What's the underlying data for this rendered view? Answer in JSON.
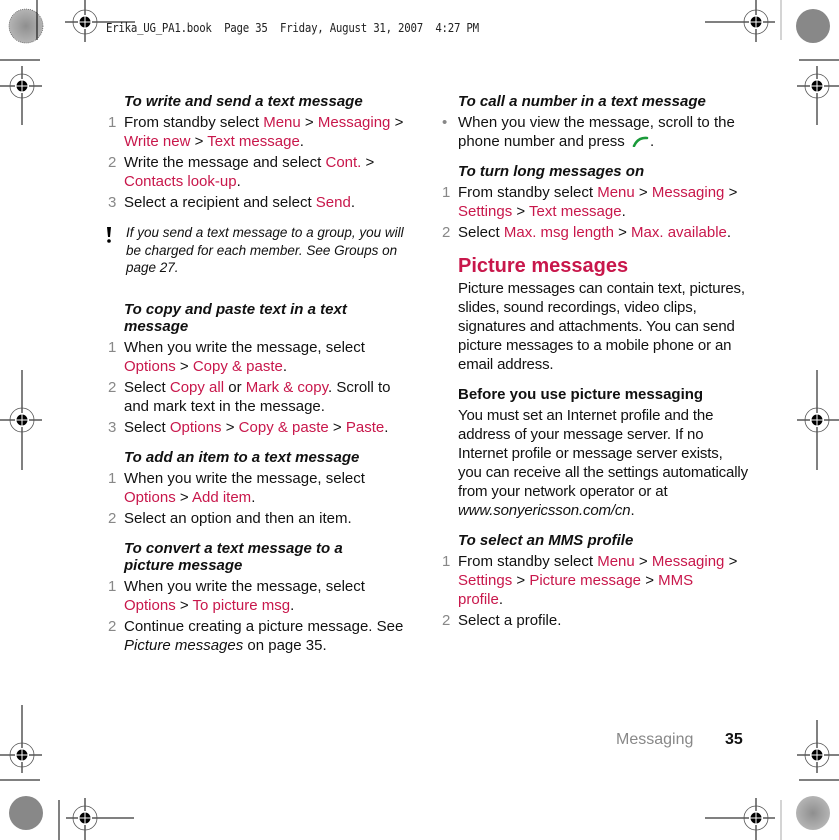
{
  "print_header": "Erika_UG_PA1.book  Page 35  Friday, August 31, 2007  4:27 PM",
  "colors": {
    "accent": "#c8174b",
    "step_number": "#888888",
    "call_key": "#1a9a3a"
  },
  "left_column": {
    "write_send": {
      "heading": "To write and send a text message",
      "steps": [
        {
          "num": "1",
          "parts": [
            "From standby select ",
            {
              "link": "Menu"
            },
            " > ",
            {
              "link": "Messaging"
            },
            " > ",
            {
              "link": "Write new"
            },
            " > ",
            {
              "link": "Text message"
            },
            "."
          ]
        },
        {
          "num": "2",
          "parts": [
            "Write the message and select ",
            {
              "link": "Cont."
            },
            " > ",
            {
              "link": "Contacts look-up"
            },
            "."
          ]
        },
        {
          "num": "3",
          "parts": [
            "Select a recipient and select ",
            {
              "link": "Send"
            },
            "."
          ]
        }
      ]
    },
    "note": {
      "icon": "warning-icon",
      "text": "If you send a text message to a group, you will be charged for each member. See Groups on page 27."
    },
    "copy_paste": {
      "heading": "To copy and paste text in a text message",
      "steps": [
        {
          "num": "1",
          "parts": [
            "When you write the message, select ",
            {
              "link": "Options"
            },
            " > ",
            {
              "link": "Copy & paste"
            },
            "."
          ]
        },
        {
          "num": "2",
          "parts": [
            "Select ",
            {
              "link": "Copy all"
            },
            " or ",
            {
              "link": "Mark & copy"
            },
            ". Scroll to and mark text in the message."
          ]
        },
        {
          "num": "3",
          "parts": [
            "Select ",
            {
              "link": "Options"
            },
            " > ",
            {
              "link": "Copy & paste"
            },
            " > ",
            {
              "link": "Paste"
            },
            "."
          ]
        }
      ]
    },
    "add_item": {
      "heading": "To add an item to a text message",
      "steps": [
        {
          "num": "1",
          "parts": [
            "When you write the message, select ",
            {
              "link": "Options"
            },
            " > ",
            {
              "link": "Add item"
            },
            "."
          ]
        },
        {
          "num": "2",
          "parts": [
            "Select an option and then an item."
          ]
        }
      ]
    },
    "convert": {
      "heading": "To convert a text message to a picture message",
      "steps": [
        {
          "num": "1",
          "parts": [
            "When you write the message, select ",
            {
              "link": "Options"
            },
            " > ",
            {
              "link": "To picture msg"
            },
            "."
          ]
        },
        {
          "num": "2",
          "parts": [
            "Continue creating a picture message. See ",
            {
              "italic": "Picture messages"
            },
            " on page 35."
          ]
        }
      ]
    }
  },
  "right_column": {
    "call_number": {
      "heading": "To call a number in a text message",
      "bullet": "•",
      "text": "When you view the message, scroll to the phone number and press",
      "icon": "call-key-icon",
      "trail": "."
    },
    "long_messages": {
      "heading": "To turn long messages on",
      "steps": [
        {
          "num": "1",
          "parts": [
            "From standby select ",
            {
              "link": "Menu"
            },
            " > ",
            {
              "link": "Messaging"
            },
            " > ",
            {
              "link": "Settings"
            },
            " > ",
            {
              "link": "Text message"
            },
            "."
          ]
        },
        {
          "num": "2",
          "parts": [
            "Select ",
            {
              "link": "Max. msg length"
            },
            " > ",
            {
              "link": "Max. available"
            },
            "."
          ]
        }
      ]
    },
    "picture_messages": {
      "title": "Picture messages",
      "body": "Picture messages can contain text, pictures, slides, sound recordings, video clips, signatures and attachments. You can send picture messages to a mobile phone or an email address."
    },
    "before_use": {
      "heading": "Before you use picture messaging",
      "body": "You must set an Internet profile and the address of your message server. If no Internet profile or message server exists, you can receive all the settings automatically from your network operator or at",
      "url": "www.sonyericsson.com/cn",
      "trail": "."
    },
    "mms_profile": {
      "heading": "To select an MMS profile",
      "steps": [
        {
          "num": "1",
          "parts": [
            "From standby select ",
            {
              "link": "Menu"
            },
            " > ",
            {
              "link": "Messaging"
            },
            " > ",
            {
              "link": "Settings"
            },
            " > ",
            {
              "link": "Picture message"
            },
            " > ",
            {
              "link": "MMS profile"
            },
            "."
          ]
        },
        {
          "num": "2",
          "parts": [
            "Select a profile."
          ]
        }
      ]
    }
  },
  "footer": {
    "section": "Messaging",
    "page_number": "35"
  }
}
